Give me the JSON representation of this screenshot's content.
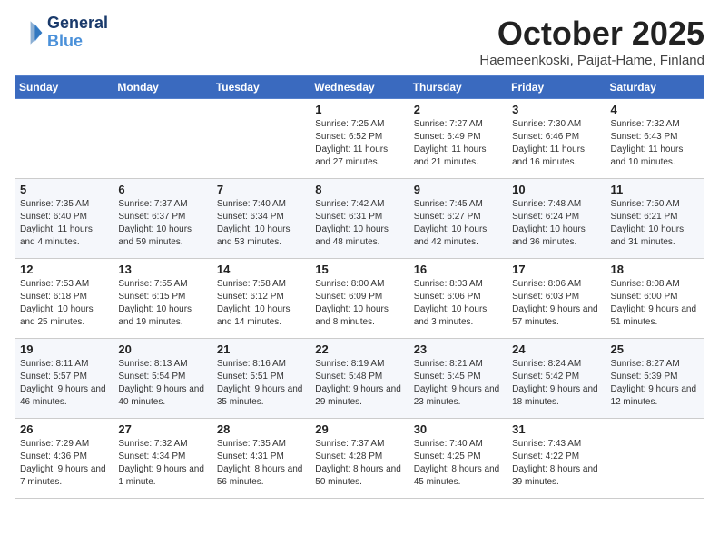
{
  "header": {
    "logo": {
      "line1": "General",
      "line2": "Blue"
    },
    "title": "October 2025",
    "location": "Haemeenkoski, Paijat-Hame, Finland"
  },
  "weekdays": [
    "Sunday",
    "Monday",
    "Tuesday",
    "Wednesday",
    "Thursday",
    "Friday",
    "Saturday"
  ],
  "weeks": [
    [
      {
        "day": "",
        "info": ""
      },
      {
        "day": "",
        "info": ""
      },
      {
        "day": "",
        "info": ""
      },
      {
        "day": "1",
        "info": "Sunrise: 7:25 AM\nSunset: 6:52 PM\nDaylight: 11 hours\nand 27 minutes."
      },
      {
        "day": "2",
        "info": "Sunrise: 7:27 AM\nSunset: 6:49 PM\nDaylight: 11 hours\nand 21 minutes."
      },
      {
        "day": "3",
        "info": "Sunrise: 7:30 AM\nSunset: 6:46 PM\nDaylight: 11 hours\nand 16 minutes."
      },
      {
        "day": "4",
        "info": "Sunrise: 7:32 AM\nSunset: 6:43 PM\nDaylight: 11 hours\nand 10 minutes."
      }
    ],
    [
      {
        "day": "5",
        "info": "Sunrise: 7:35 AM\nSunset: 6:40 PM\nDaylight: 11 hours\nand 4 minutes."
      },
      {
        "day": "6",
        "info": "Sunrise: 7:37 AM\nSunset: 6:37 PM\nDaylight: 10 hours\nand 59 minutes."
      },
      {
        "day": "7",
        "info": "Sunrise: 7:40 AM\nSunset: 6:34 PM\nDaylight: 10 hours\nand 53 minutes."
      },
      {
        "day": "8",
        "info": "Sunrise: 7:42 AM\nSunset: 6:31 PM\nDaylight: 10 hours\nand 48 minutes."
      },
      {
        "day": "9",
        "info": "Sunrise: 7:45 AM\nSunset: 6:27 PM\nDaylight: 10 hours\nand 42 minutes."
      },
      {
        "day": "10",
        "info": "Sunrise: 7:48 AM\nSunset: 6:24 PM\nDaylight: 10 hours\nand 36 minutes."
      },
      {
        "day": "11",
        "info": "Sunrise: 7:50 AM\nSunset: 6:21 PM\nDaylight: 10 hours\nand 31 minutes."
      }
    ],
    [
      {
        "day": "12",
        "info": "Sunrise: 7:53 AM\nSunset: 6:18 PM\nDaylight: 10 hours\nand 25 minutes."
      },
      {
        "day": "13",
        "info": "Sunrise: 7:55 AM\nSunset: 6:15 PM\nDaylight: 10 hours\nand 19 minutes."
      },
      {
        "day": "14",
        "info": "Sunrise: 7:58 AM\nSunset: 6:12 PM\nDaylight: 10 hours\nand 14 minutes."
      },
      {
        "day": "15",
        "info": "Sunrise: 8:00 AM\nSunset: 6:09 PM\nDaylight: 10 hours\nand 8 minutes."
      },
      {
        "day": "16",
        "info": "Sunrise: 8:03 AM\nSunset: 6:06 PM\nDaylight: 10 hours\nand 3 minutes."
      },
      {
        "day": "17",
        "info": "Sunrise: 8:06 AM\nSunset: 6:03 PM\nDaylight: 9 hours\nand 57 minutes."
      },
      {
        "day": "18",
        "info": "Sunrise: 8:08 AM\nSunset: 6:00 PM\nDaylight: 9 hours\nand 51 minutes."
      }
    ],
    [
      {
        "day": "19",
        "info": "Sunrise: 8:11 AM\nSunset: 5:57 PM\nDaylight: 9 hours\nand 46 minutes."
      },
      {
        "day": "20",
        "info": "Sunrise: 8:13 AM\nSunset: 5:54 PM\nDaylight: 9 hours\nand 40 minutes."
      },
      {
        "day": "21",
        "info": "Sunrise: 8:16 AM\nSunset: 5:51 PM\nDaylight: 9 hours\nand 35 minutes."
      },
      {
        "day": "22",
        "info": "Sunrise: 8:19 AM\nSunset: 5:48 PM\nDaylight: 9 hours\nand 29 minutes."
      },
      {
        "day": "23",
        "info": "Sunrise: 8:21 AM\nSunset: 5:45 PM\nDaylight: 9 hours\nand 23 minutes."
      },
      {
        "day": "24",
        "info": "Sunrise: 8:24 AM\nSunset: 5:42 PM\nDaylight: 9 hours\nand 18 minutes."
      },
      {
        "day": "25",
        "info": "Sunrise: 8:27 AM\nSunset: 5:39 PM\nDaylight: 9 hours\nand 12 minutes."
      }
    ],
    [
      {
        "day": "26",
        "info": "Sunrise: 7:29 AM\nSunset: 4:36 PM\nDaylight: 9 hours\nand 7 minutes."
      },
      {
        "day": "27",
        "info": "Sunrise: 7:32 AM\nSunset: 4:34 PM\nDaylight: 9 hours\nand 1 minute."
      },
      {
        "day": "28",
        "info": "Sunrise: 7:35 AM\nSunset: 4:31 PM\nDaylight: 8 hours\nand 56 minutes."
      },
      {
        "day": "29",
        "info": "Sunrise: 7:37 AM\nSunset: 4:28 PM\nDaylight: 8 hours\nand 50 minutes."
      },
      {
        "day": "30",
        "info": "Sunrise: 7:40 AM\nSunset: 4:25 PM\nDaylight: 8 hours\nand 45 minutes."
      },
      {
        "day": "31",
        "info": "Sunrise: 7:43 AM\nSunset: 4:22 PM\nDaylight: 8 hours\nand 39 minutes."
      },
      {
        "day": "",
        "info": ""
      }
    ]
  ]
}
